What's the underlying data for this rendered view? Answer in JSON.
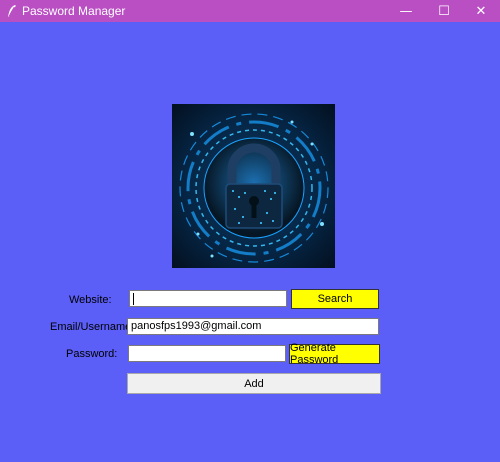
{
  "window": {
    "title": "Password Manager",
    "minimize_glyph": "—",
    "maximize_glyph": "☐",
    "close_glyph": "✕",
    "icon": "feather-icon"
  },
  "logo": {
    "icon": "padlock-icon",
    "colors": {
      "glow": "#1aa3ff",
      "dark": "#061624"
    }
  },
  "form": {
    "website_label": "Website:",
    "website_value": "",
    "email_label": "Email/Username:",
    "email_value": "panosfps1993@gmail.com",
    "password_label": "Password:",
    "password_value": "",
    "search_button": "Search",
    "generate_button": "Generate Password",
    "add_button": "Add"
  },
  "colors": {
    "background": "#5b5ef7",
    "titlebar": "#b94fc3",
    "accent_button": "#ffff00"
  }
}
